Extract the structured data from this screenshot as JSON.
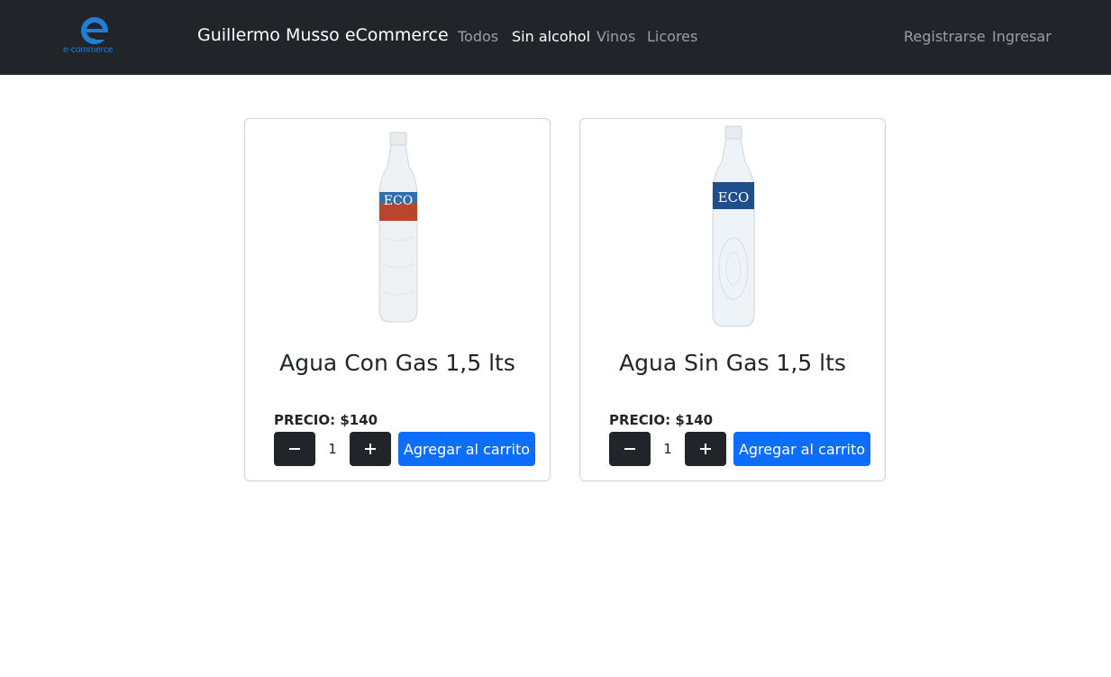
{
  "navbar": {
    "logo_text": "e-commerce",
    "brand_title": "Guillermo Musso eCommerce",
    "links": [
      {
        "label": "Todos"
      },
      {
        "label": "Sin alcohol"
      },
      {
        "label": "Vinos"
      },
      {
        "label": "Licores"
      }
    ],
    "right_links": [
      {
        "label": "Registrarse"
      },
      {
        "label": "Ingresar"
      }
    ]
  },
  "products": [
    {
      "title": "Agua Con Gas 1,5 lts",
      "price_label": "PRECIO: $140",
      "quantity": "1",
      "add_label": "Agregar al carrito",
      "bottle_label": "ECO",
      "label_color": "#b8452c",
      "minus_icon": "minus-icon",
      "plus_icon": "plus-icon"
    },
    {
      "title": "Agua Sin Gas 1,5 lts",
      "price_label": "PRECIO: $140",
      "quantity": "1",
      "add_label": "Agregar al carrito",
      "bottle_label": "ECO",
      "label_color": "#1f4e8c",
      "minus_icon": "minus-icon",
      "plus_icon": "plus-icon"
    }
  ],
  "colors": {
    "navbar_bg": "#212529",
    "primary": "#0d6efd",
    "brand_blue": "#1e7fd6"
  }
}
